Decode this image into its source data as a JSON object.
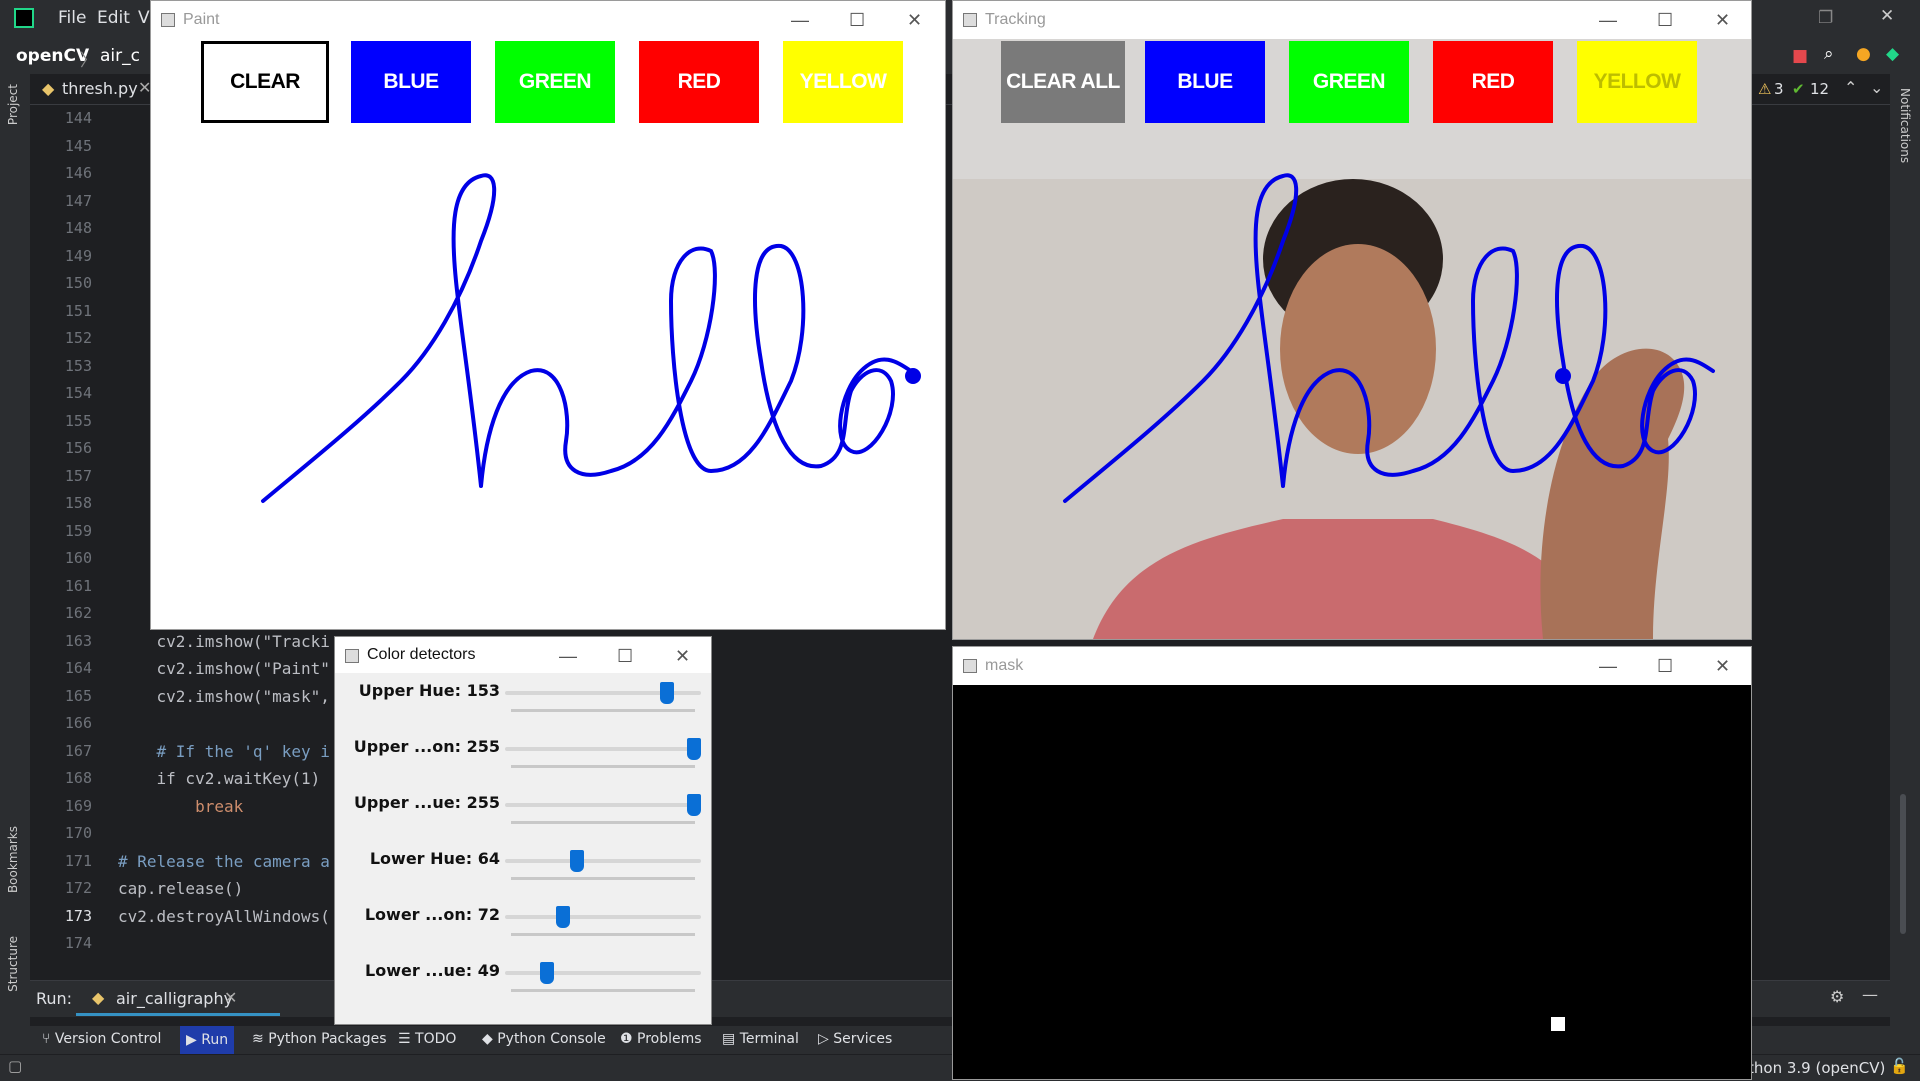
{
  "ide": {
    "menu": [
      "File",
      "Edit",
      "V"
    ],
    "project": "openCV",
    "breadcrumb_file": "air_c",
    "tab": "thresh.py",
    "inspection": {
      "warnings": "3",
      "ok": "12"
    },
    "line_numbers": [
      "144",
      "145",
      "146",
      "147",
      "148",
      "149",
      "150",
      "151",
      "152",
      "153",
      "154",
      "155",
      "156",
      "157",
      "158",
      "159",
      "160",
      "161",
      "162",
      "163",
      "164",
      "165",
      "166",
      "167",
      "168",
      "169",
      "170",
      "171",
      "172",
      "173",
      "174"
    ],
    "code_lines": [
      {
        "line": "163",
        "text": "    cv2.imshow(\"Tracki"
      },
      {
        "line": "164",
        "text": "    cv2.imshow(\"Paint\""
      },
      {
        "line": "165",
        "text": "    cv2.imshow(\"mask\","
      },
      {
        "line": "167",
        "text": "    # If the 'q' key i"
      },
      {
        "line": "168",
        "text": "    if cv2.waitKey(1)"
      },
      {
        "line": "169",
        "text": "        break"
      },
      {
        "line": "171",
        "text": "# Release the camera a"
      },
      {
        "line": "172",
        "text": "cap.release()"
      },
      {
        "line": "173",
        "text": "cv2.destroyAllWindows("
      }
    ],
    "run": {
      "label": "Run:",
      "config": "air_calligraphy"
    },
    "left_strip": {
      "project": "Project",
      "bookmarks": "Bookmarks",
      "structure": "Structure"
    },
    "right_strip": {
      "notifications": "Notifications"
    },
    "bottom_tools": [
      "Version Control",
      "Run",
      "Python Packages",
      "TODO",
      "Python Console",
      "Problems",
      "Terminal",
      "Services"
    ],
    "interpreter": "thon 3.9 (openCV)"
  },
  "paint_window": {
    "title": "Paint",
    "buttons": [
      {
        "label": "CLEAR",
        "bg": "#ffffff",
        "fg": "#000000"
      },
      {
        "label": "BLUE",
        "bg": "#0000ff",
        "fg": "#ffffff"
      },
      {
        "label": "GREEN",
        "bg": "#00ff00",
        "fg": "#ffffff"
      },
      {
        "label": "RED",
        "bg": "#ff0000",
        "fg": "#ffffff"
      },
      {
        "label": "YELLOW",
        "bg": "#ffff00",
        "fg": "#ffffff"
      }
    ]
  },
  "tracking_window": {
    "title": "Tracking",
    "buttons": [
      {
        "label": "CLEAR ALL",
        "bg": "#7a7a7a",
        "fg": "#ffffff"
      },
      {
        "label": "BLUE",
        "bg": "#0000ff",
        "fg": "#ffffff"
      },
      {
        "label": "GREEN",
        "bg": "#00ff00",
        "fg": "#ffffff"
      },
      {
        "label": "RED",
        "bg": "#ff0000",
        "fg": "#ffffff"
      },
      {
        "label": "YELLOW",
        "bg": "#ffff00",
        "fg": "#bdbd00"
      }
    ]
  },
  "mask_window": {
    "title": "mask"
  },
  "color_detectors": {
    "title": "Color detectors",
    "trackbars": [
      {
        "label": "Upper Hue: 153",
        "value": 153,
        "max": 180
      },
      {
        "label": "Upper ...on: 255",
        "value": 255,
        "max": 255
      },
      {
        "label": "Upper ...ue: 255",
        "value": 255,
        "max": 255
      },
      {
        "label": "Lower Hue: 64",
        "value": 64,
        "max": 180
      },
      {
        "label": "Lower ...on: 72",
        "value": 72,
        "max": 255
      },
      {
        "label": "Lower ...ue: 49",
        "value": 49,
        "max": 255
      }
    ]
  },
  "colors": {
    "ink": "#0000e6",
    "ide_bg": "#1e1f22",
    "slider": "#0a6fd6"
  }
}
